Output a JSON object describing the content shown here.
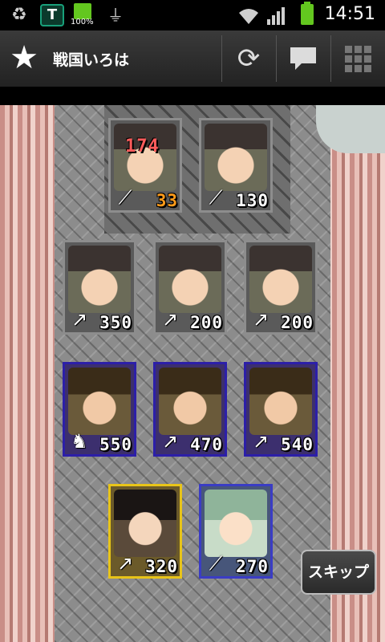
{
  "status_bar": {
    "battery_small_label": "100%",
    "time": "14:51",
    "icons": [
      "recycle-icon",
      "shield-t-icon",
      "battery-icon",
      "usb-icon",
      "wifi-icon",
      "signal-icon",
      "battery-icon"
    ]
  },
  "action_bar": {
    "title": "戦国いろは",
    "buttons": [
      "refresh-icon",
      "chat-icon",
      "grid-menu-icon"
    ]
  },
  "cards": [
    {
      "row": 1,
      "frame": "gray",
      "overlay": "174",
      "value": "33",
      "value_color": "#ff9b1a",
      "weapon": "bow"
    },
    {
      "row": 1,
      "frame": "gray",
      "value": "130",
      "weapon": "bow"
    },
    {
      "row": 2,
      "frame": "gray",
      "value": "350",
      "weapon": "spear"
    },
    {
      "row": 2,
      "frame": "gray",
      "value": "200",
      "weapon": "spear"
    },
    {
      "row": 2,
      "frame": "gray",
      "value": "200",
      "weapon": "spear"
    },
    {
      "row": 3,
      "frame": "purple",
      "value": "550",
      "weapon": "horse"
    },
    {
      "row": 3,
      "frame": "purple",
      "value": "470",
      "weapon": "spear"
    },
    {
      "row": 3,
      "frame": "purple",
      "value": "540",
      "weapon": "spear"
    },
    {
      "row": 4,
      "frame": "gold",
      "value": "320",
      "weapon": "spear"
    },
    {
      "row": 4,
      "frame": "blue",
      "value": "270",
      "weapon": "bow"
    }
  ],
  "skip_label": "スキップ"
}
